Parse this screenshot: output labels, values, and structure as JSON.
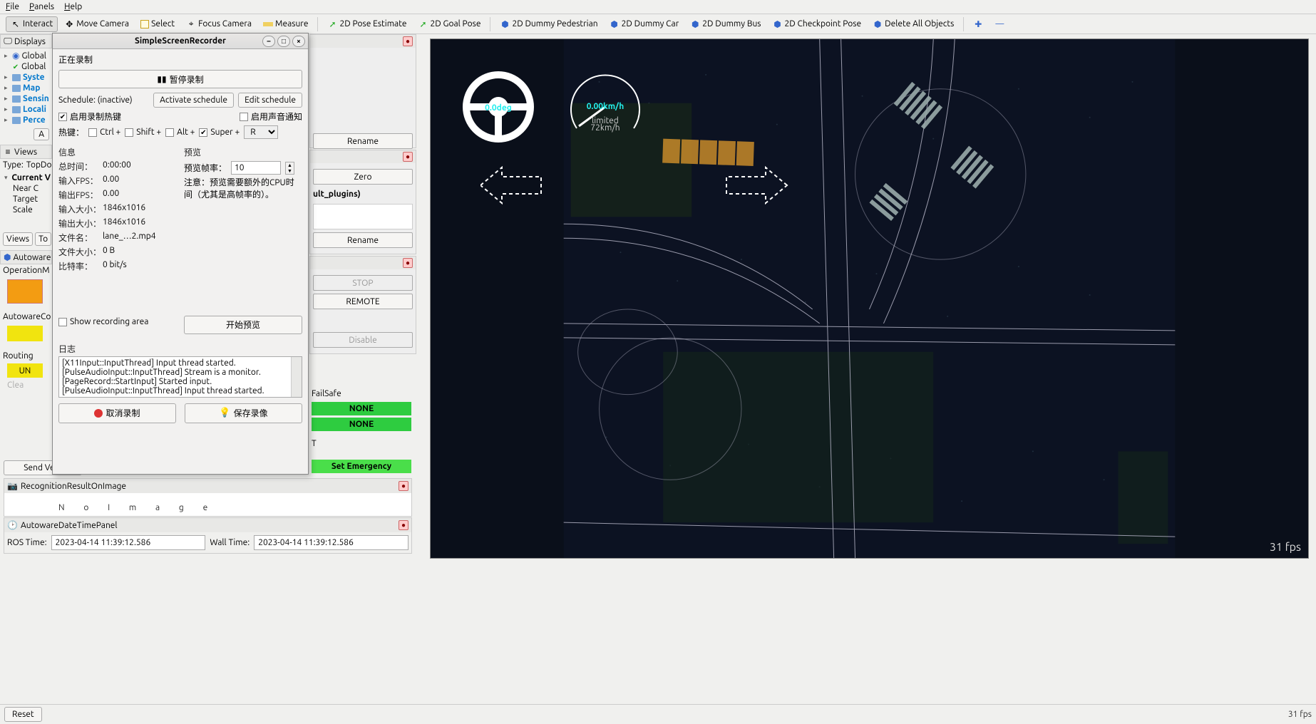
{
  "menubar": {
    "file": "File",
    "panels": "Panels",
    "help": "Help"
  },
  "toolbar": {
    "interact": "Interact",
    "move": "Move Camera",
    "select": "Select",
    "focus": "Focus Camera",
    "measure": "Measure",
    "pose": "2D Pose Estimate",
    "goal": "2D Goal Pose",
    "ped": "2D Dummy Pedestrian",
    "car": "2D Dummy Car",
    "bus": "2D Dummy Bus",
    "chk": "2D Checkpoint Pose",
    "del": "Delete All Objects"
  },
  "displays": {
    "title": "Displays",
    "items": [
      {
        "label": "Global",
        "check": true,
        "t": "globe"
      },
      {
        "label": "Global",
        "check": true,
        "t": "globe"
      },
      {
        "label": "Syste",
        "t": "folder",
        "bold": true,
        "blue": true
      },
      {
        "label": "Map",
        "t": "folder",
        "bold": true,
        "blue": true
      },
      {
        "label": "Sensin",
        "t": "folder",
        "bold": true,
        "blue": true
      },
      {
        "label": "Locali",
        "t": "folder",
        "bold": true,
        "blue": true
      },
      {
        "label": "Perce",
        "t": "folder",
        "bold": true,
        "blue": true
      }
    ],
    "a_label": "A"
  },
  "views": {
    "title": "Views",
    "type_label": "Type:",
    "type_value": "TopDo",
    "current": "Current V",
    "near": "Near C",
    "target": "Target",
    "scale": "Scale",
    "views_btn": "Views",
    "t_btn": "To"
  },
  "autoware_panel": {
    "title": "Autoware",
    "op": "OperationM",
    "autocont": "AutowareCo",
    "routing": "Routing",
    "un": "UN",
    "clear": "Clea",
    "send_vel": "Send Velo"
  },
  "peek_panels": {
    "ult": "ult_plugins)",
    "rename": "Rename",
    "zero": "Zero",
    "stop": "STOP",
    "remote": "REMOTE",
    "disable": "Disable",
    "t_label": "T"
  },
  "failsafe": {
    "label": "FailSafe",
    "none": "NONE"
  },
  "set_emergency": "Set Emergency",
  "recog": {
    "title": "RecognitionResultOnImage"
  },
  "datetime": {
    "title": "AutowareDateTimePanel",
    "ros": "ROS Time:",
    "wall": "Wall Time:",
    "ros_v": "2023-04-14 11:39:12.586",
    "wall_v": "2023-04-14 11:39:12.586"
  },
  "reset": "Reset",
  "fps": "31 fps",
  "hud": {
    "deg": "0.0deg",
    "speed": "0.00km/h",
    "limited": "limited",
    "limit": "72km/h"
  },
  "ssr": {
    "title": "SimpleScreenRecorder",
    "recording": "正在录制",
    "pause": "暂停录制",
    "schedule": "Schedule: (inactive)",
    "activate": "Activate schedule",
    "edit": "Edit schedule",
    "enable_hotkey": "启用录制热键",
    "enable_sound": "启用声音通知",
    "hotkey": "热键：",
    "ctrl": "Ctrl +",
    "shift": "Shift +",
    "alt": "Alt +",
    "super": "Super +",
    "key": "R",
    "info": "信息",
    "preview": "预览",
    "total": "总时间：",
    "total_v": "0:00:00",
    "infps": "输入FPS：",
    "infps_v": "0.00",
    "outfps": "输出FPS：",
    "outfps_v": "0.00",
    "insize": "输入大小：",
    "insize_v": "1846x1016",
    "outsize": "输出大小：",
    "outsize_v": "1846x1016",
    "fname": "文件名：",
    "fname_v": "lane_…2.mp4",
    "fsize": "文件大小：",
    "fsize_v": "0 B",
    "bitrate": "比特率：",
    "bitrate_v": "0 bit/s",
    "showarea": "Show recording area",
    "prate": "预览帧率：",
    "prate_v": "10",
    "pnote": "注意：预览需要额外的CPU时间（尤其是高帧率的）。",
    "startp": "开始预览",
    "log": "日志",
    "log_lines": [
      "[X11Input::InputThread] Input thread started.",
      "[PulseAudioInput::InputThread] Stream is a monitor.",
      "[PageRecord::StartInput] Started input.",
      "[PulseAudioInput::InputThread] Input thread started."
    ],
    "cancel": "取消录制",
    "save": "保存录像"
  },
  "svl": {
    "unit": "[km/h]"
  }
}
